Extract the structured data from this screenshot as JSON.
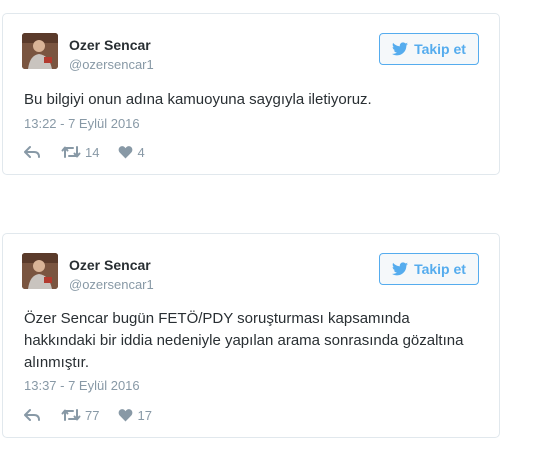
{
  "colors": {
    "accent": "#55acee",
    "text": "#292f33",
    "muted": "#8899a6",
    "border": "#e1e8ed"
  },
  "tweets": [
    {
      "author": {
        "name": "Ozer Sencar",
        "handle": "@ozersencar1",
        "avatar_icon": "profile-photo"
      },
      "follow_label": "Takip et",
      "text": "Bu bilgiyi onun adına kamuoyuna saygıyla iletiyoruz.",
      "timestamp": "13:22 - 7 Eylül 2016",
      "retweets": "14",
      "likes": "4"
    },
    {
      "author": {
        "name": "Ozer Sencar",
        "handle": "@ozersencar1",
        "avatar_icon": "profile-photo"
      },
      "follow_label": "Takip et",
      "text": "Özer Sencar bugün FETÖ/PDY soruşturması kapsamında hakkındaki bir iddia nedeniyle yapılan arama sonrasında gözaltına alınmıştır.",
      "timestamp": "13:37 - 7 Eylül 2016",
      "retweets": "77",
      "likes": "17"
    }
  ]
}
